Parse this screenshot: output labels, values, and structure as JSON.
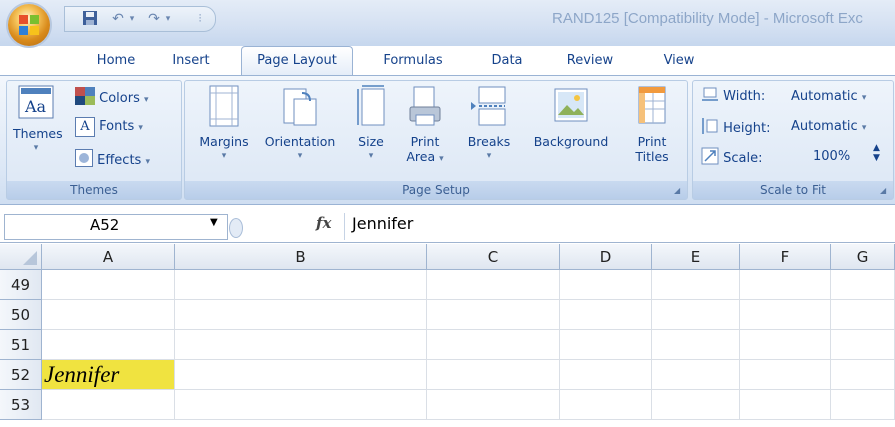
{
  "window": {
    "title": "RAND125 [Compatibility Mode] - Microsoft Exc"
  },
  "quick_access": {
    "icons": [
      "save-icon",
      "undo-icon",
      "redo-icon",
      "customize-icon"
    ]
  },
  "tabs": [
    {
      "label": "Home",
      "active": false
    },
    {
      "label": "Insert",
      "active": false
    },
    {
      "label": "Page Layout",
      "active": true
    },
    {
      "label": "Formulas",
      "active": false
    },
    {
      "label": "Data",
      "active": false
    },
    {
      "label": "Review",
      "active": false
    },
    {
      "label": "View",
      "active": false
    }
  ],
  "ribbon": {
    "themes": {
      "group_label": "Themes",
      "themes_label": "Themes",
      "colors_label": "Colors",
      "fonts_label": "Fonts",
      "effects_label": "Effects"
    },
    "page_setup": {
      "group_label": "Page Setup",
      "margins_label": "Margins",
      "orientation_label": "Orientation",
      "size_label": "Size",
      "print_area_label_1": "Print",
      "print_area_label_2": "Area",
      "breaks_label": "Breaks",
      "background_label": "Background",
      "print_titles_label_1": "Print",
      "print_titles_label_2": "Titles"
    },
    "scale_to_fit": {
      "group_label": "Scale to Fit",
      "width_label": "Width:",
      "width_value": "Automatic",
      "height_label": "Height:",
      "height_value": "Automatic",
      "scale_label": "Scale:",
      "scale_value": "100%"
    }
  },
  "formula_bar": {
    "name_box": "A52",
    "fx_label": "fx",
    "value": "Jennifer"
  },
  "sheet": {
    "columns": [
      "A",
      "B",
      "C",
      "D",
      "E",
      "F",
      "G"
    ],
    "rows": [
      "49",
      "50",
      "51",
      "52",
      "53"
    ],
    "cells": {
      "A52": {
        "value": "Jennifer",
        "fill": "#f0e340"
      }
    }
  }
}
